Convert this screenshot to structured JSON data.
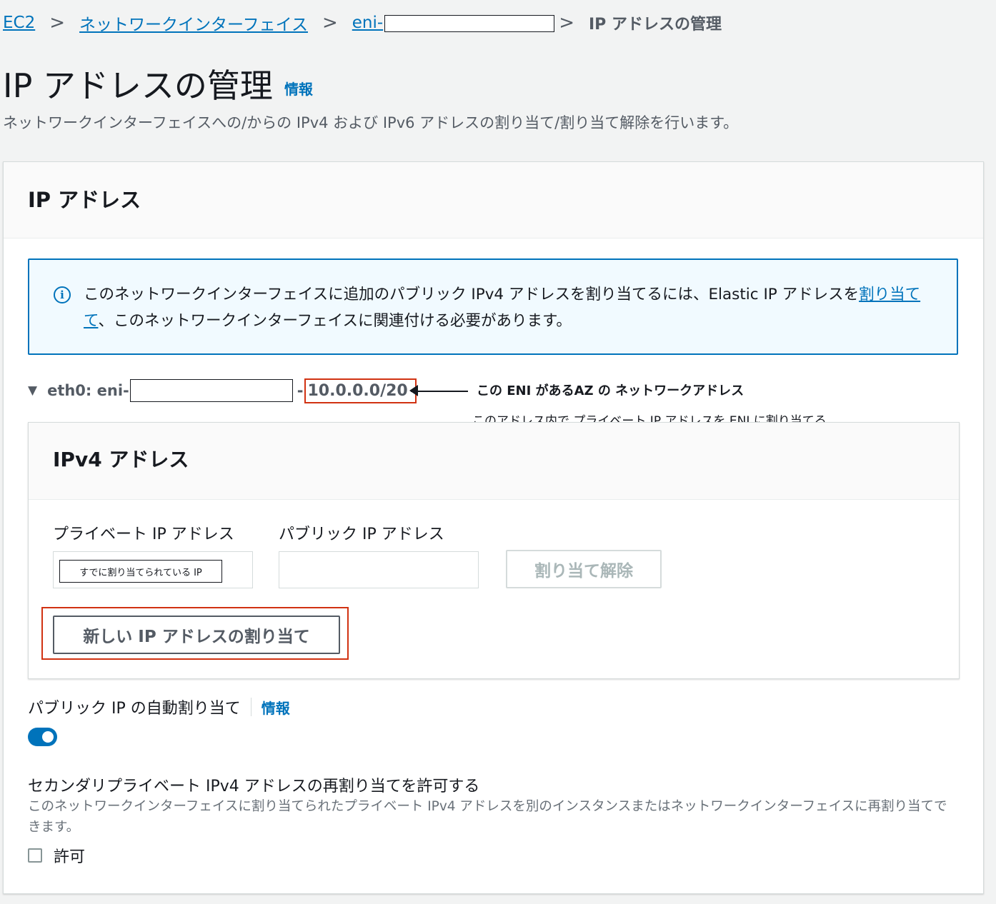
{
  "breadcrumb": {
    "items": [
      "EC2",
      "ネットワークインターフェイス",
      "eni-"
    ],
    "separator": ">",
    "current": "IP アドレスの管理"
  },
  "page": {
    "title": "IP アドレスの管理",
    "info_link": "情報",
    "description": "ネットワークインターフェイスへの/からの IPv4 および IPv6 アドレスの割り当て/割り当て解除を行います。"
  },
  "panel": {
    "title": "IP アドレス"
  },
  "alert": {
    "icon": "info-circle-icon",
    "text_before": "このネットワークインターフェイスに追加のパブリック IPv4 アドレスを割り当てるには、Elastic IP アドレスを",
    "link": "割り当てて",
    "text_after": "、このネットワークインターフェイスに関連付ける必要があります。"
  },
  "interface": {
    "label": "eth0: eni-",
    "dash": "-",
    "cidr": "10.0.0.0/20"
  },
  "annotations": {
    "line1": "この ENI があるAZ の ネットワークアドレス",
    "line2": "このアドレス内で プライベート IP アドレスを ENI に割り当てる"
  },
  "ipv4": {
    "title": "IPv4 アドレス",
    "private_label": "プライベート IP アドレス",
    "public_label": "パブリック IP アドレス",
    "private_value": "すでに割り当てられている IP",
    "public_value": "",
    "unassign_button": "割り当て解除",
    "assign_new_button": "新しい IP アドレスの割り当て"
  },
  "auto_assign": {
    "label": "パブリック IP の自動割り当て",
    "info_link": "情報",
    "enabled": true
  },
  "reassign": {
    "title": "セカンダリプライベート IPv4 アドレスの再割り当てを許可する",
    "description": "このネットワークインターフェイスに割り当てられたプライベート IPv4 アドレスを別のインスタンスまたはネットワークインターフェイスに再割り当てできます。",
    "checkbox_label": "許可",
    "checked": false
  },
  "colors": {
    "link": "#0073bb",
    "highlight": "#d13212",
    "background": "#f2f3f3"
  }
}
